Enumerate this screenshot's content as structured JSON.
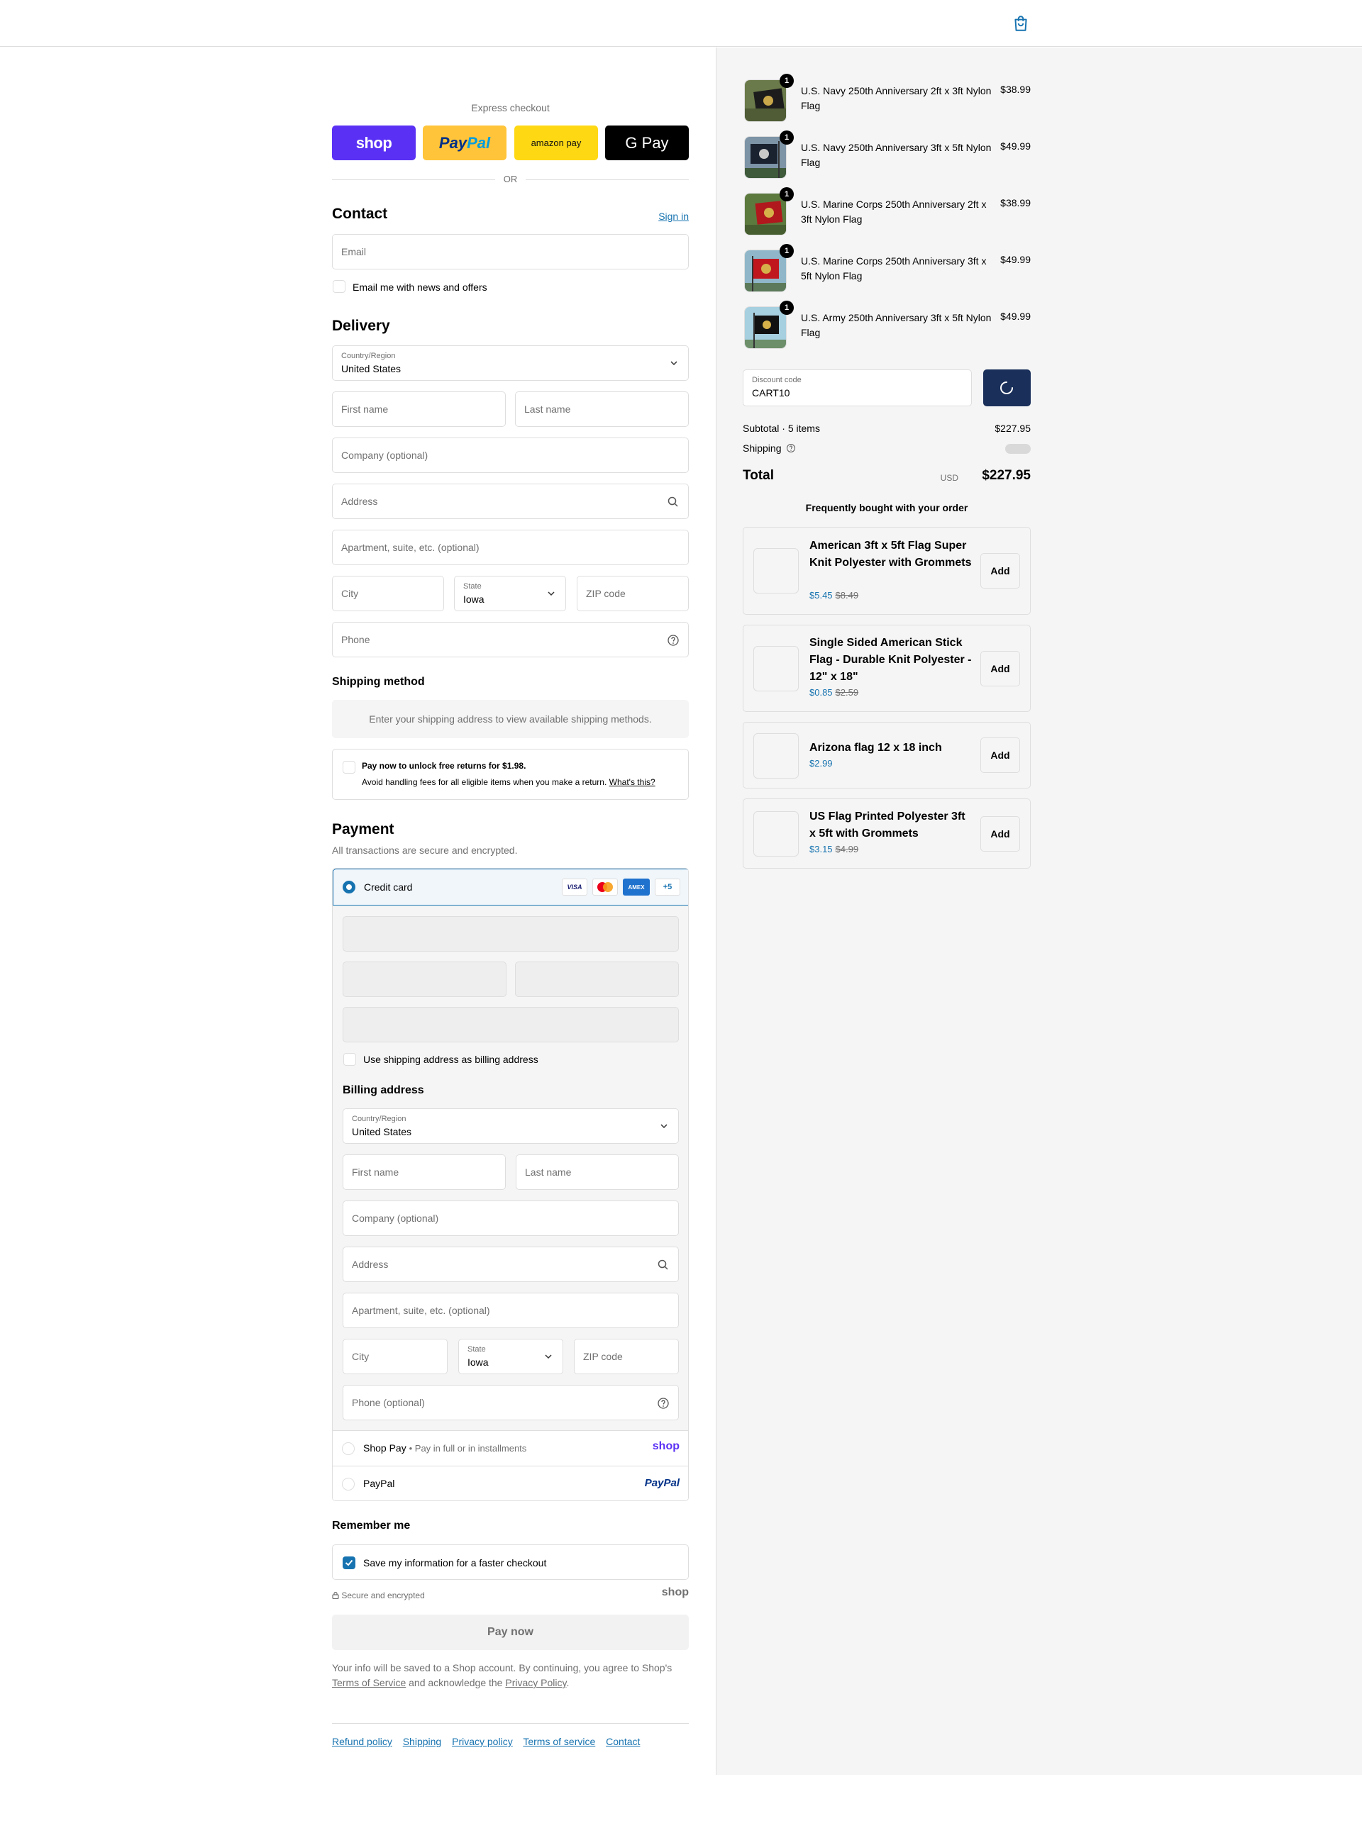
{
  "express": {
    "title": "Express checkout",
    "shop": "shop",
    "paypal_1": "Pay",
    "paypal_2": "Pal",
    "amazon": "amazon pay",
    "gpay": "G Pay",
    "or": "OR"
  },
  "contact": {
    "heading": "Contact",
    "signin": "Sign in",
    "email_placeholder": "Email",
    "news_label": "Email me with news and offers"
  },
  "delivery": {
    "heading": "Delivery",
    "country_label": "Country/Region",
    "country_value": "United States",
    "first_name": "First name",
    "last_name": "Last name",
    "company": "Company (optional)",
    "address": "Address",
    "apartment": "Apartment, suite, etc. (optional)",
    "city": "City",
    "state_label": "State",
    "state_value": "Iowa",
    "zip": "ZIP code",
    "phone": "Phone"
  },
  "shipping_method": {
    "heading": "Shipping method",
    "note": "Enter your shipping address to view available shipping methods."
  },
  "returns": {
    "title": "Pay now to unlock free returns for $1.98.",
    "text": "Avoid handling fees for all eligible items when you make a return.",
    "link": "What's this?"
  },
  "payment": {
    "heading": "Payment",
    "subtitle": "All transactions are secure and encrypted.",
    "credit_card": "Credit card",
    "card_logos": [
      "VISA",
      "mastercard",
      "AMEX",
      "+5"
    ],
    "use_shipping": "Use shipping address as billing address",
    "billing_heading": "Billing address",
    "billing": {
      "country_label": "Country/Region",
      "country_value": "United States",
      "first_name": "First name",
      "last_name": "Last name",
      "company": "Company (optional)",
      "address": "Address",
      "apartment": "Apartment, suite, etc. (optional)",
      "city": "City",
      "state_label": "State",
      "state_value": "Iowa",
      "zip": "ZIP code",
      "phone": "Phone (optional)"
    },
    "shop_pay": "Shop Pay",
    "shop_pay_sub": "Pay in full or in installments",
    "shop_pay_logo": "shop",
    "paypal": "PayPal",
    "paypal_logo": "PayPal"
  },
  "remember": {
    "heading": "Remember me",
    "save_label": "Save my information for a faster checkout",
    "secure": "Secure and encrypted",
    "shop_logo": "shop"
  },
  "pay_now": "Pay now",
  "legal": {
    "text1": "Your info will be saved to a Shop account. By continuing, you agree to Shop's",
    "terms": "Terms of Service",
    "text2": "and acknowledge the",
    "privacy": "Privacy Policy",
    "text3": "."
  },
  "footer": [
    "Refund policy",
    "Shipping",
    "Privacy policy",
    "Terms of service",
    "Contact"
  ],
  "summary": {
    "items": [
      {
        "name": "U.S. Navy 250th Anniversary 2ft x 3ft Nylon Flag",
        "price": "$38.99",
        "qty": "1",
        "img": "navy-flag"
      },
      {
        "name": "U.S. Navy 250th Anniversary 3ft x 5ft Nylon Flag",
        "price": "$49.99",
        "qty": "1",
        "img": "navy-flag"
      },
      {
        "name": "U.S. Marine Corps 250th Anniversary 2ft x 3ft Nylon Flag",
        "price": "$38.99",
        "qty": "1",
        "img": "marine-flag"
      },
      {
        "name": "U.S. Marine Corps 250th Anniversary 3ft x 5ft Nylon Flag",
        "price": "$49.99",
        "qty": "1",
        "img": "marine-flag"
      },
      {
        "name": "U.S. Army 250th Anniversary 3ft x 5ft Nylon Flag",
        "price": "$49.99",
        "qty": "1",
        "img": "army-flag"
      }
    ],
    "discount_label": "Discount code",
    "discount_value": "CART10",
    "subtotal_label": "Subtotal · 5 items",
    "subtotal_value": "$227.95",
    "shipping_label": "Shipping",
    "total_label": "Total",
    "total_currency": "USD",
    "total_value": "$227.95",
    "fbt_title": "Frequently bought with your order",
    "upsells": [
      {
        "name": "American 3ft x 5ft Flag Super Knit Polyester with Grommets",
        "price": "$5.45",
        "was": "$8.49",
        "add": "Add"
      },
      {
        "name": "Single Sided American Stick Flag - Durable Knit Polyester - 12\" x 18\"",
        "price": "$0.85",
        "was": "$2.59",
        "add": "Add"
      },
      {
        "name": "Arizona flag 12 x 18 inch",
        "price": "$2.99",
        "was": "",
        "add": "Add"
      },
      {
        "name": "US Flag Printed Polyester 3ft x 5ft with Grommets",
        "price": "$3.15",
        "was": "$4.99",
        "add": "Add"
      }
    ]
  },
  "colors": {
    "accent": "#1773b0",
    "shop_purple": "#5a31f4",
    "paypal_yellow": "#ffc439",
    "amazon_yellow": "#ffd814",
    "discount_button": "#1a2f5a"
  }
}
